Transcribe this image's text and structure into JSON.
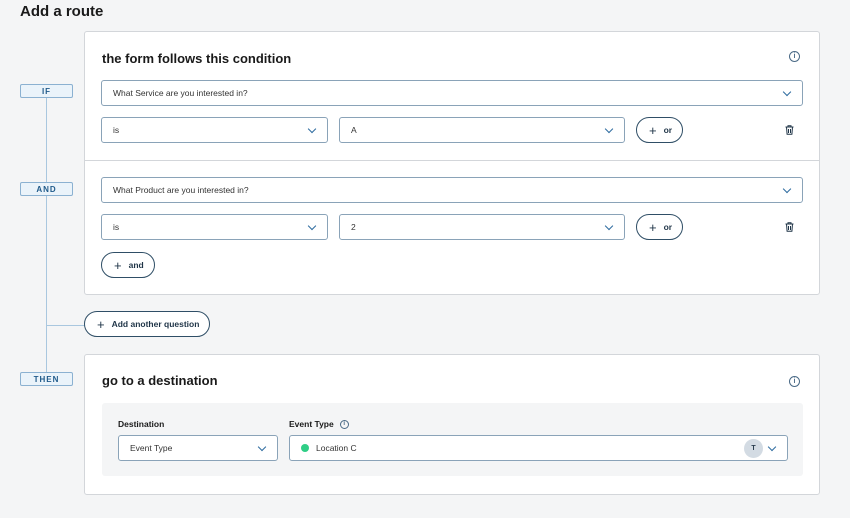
{
  "page": {
    "title": "Add a route"
  },
  "timeline": {
    "if": "IF",
    "and": "AND",
    "then": "THEN"
  },
  "condition_card": {
    "title": "the form follows this condition",
    "rules": [
      {
        "question": "What Service are you interested in?",
        "operator": "is",
        "value": "A",
        "or_label": "or"
      },
      {
        "question": "What Product are you interested in?",
        "operator": "is",
        "value": "2",
        "or_label": "or"
      }
    ],
    "and_label": "and"
  },
  "add_question_label": "Add another question",
  "destination_card": {
    "title": "go to a destination",
    "destination_label": "Destination",
    "destination_value": "Event Type",
    "event_type_label": "Event Type",
    "event_type_value": "Location C",
    "avatar_initial": "T"
  },
  "colors": {
    "accent": "#2d6b9f",
    "status_dot": "#2fce86"
  },
  "icons": [
    "info-icon",
    "chevron-down-icon",
    "plus-icon",
    "trash-icon"
  ]
}
